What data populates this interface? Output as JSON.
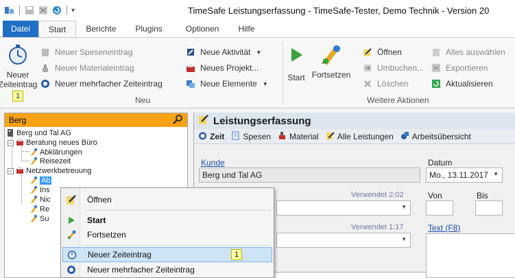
{
  "window": {
    "title": "TimeSafe Leistungserfassung - TimeSafe-Tester, Demo Technik - Version 20"
  },
  "tabs": [
    {
      "label": "Datei"
    },
    {
      "label": "Start"
    },
    {
      "label": "Berichte"
    },
    {
      "label": "Plugins"
    },
    {
      "label": "Optionen"
    },
    {
      "label": "Hilfe"
    }
  ],
  "ribbon": {
    "new_group": {
      "big_button_line1": "Neuer",
      "big_button_line2": "Zeiteintrag",
      "big_button_keytip": "1",
      "items": [
        {
          "label": "Neuer Speseneintrag",
          "icon": "expense-icon",
          "enabled": false
        },
        {
          "label": "Neuer Materialeintrag",
          "icon": "material-icon",
          "enabled": false
        },
        {
          "label": "Neuer mehrfacher Zeiteintrag",
          "icon": "multi-time-icon",
          "enabled": true
        }
      ],
      "items2": [
        {
          "label": "Neue Aktivität",
          "icon": "activity-icon",
          "dropdown": true
        },
        {
          "label": "Neues Projekt...",
          "icon": "project-icon",
          "dropdown": false
        },
        {
          "label": "Neue Elemente",
          "icon": "elements-icon",
          "dropdown": true
        }
      ],
      "label": "Neu"
    },
    "actions_group": {
      "start_label": "Start",
      "continue_label": "Fortsetzen",
      "col1": [
        {
          "label": "Öffnen",
          "icon": "open-icon",
          "enabled": true
        },
        {
          "label": "Umbuchen...",
          "icon": "rebook-icon",
          "enabled": false
        },
        {
          "label": "Löschen",
          "icon": "delete-icon",
          "enabled": false
        }
      ],
      "col2": [
        {
          "label": "Alles auswählen",
          "icon": "select-all-icon",
          "enabled": false
        },
        {
          "label": "Exportieren",
          "icon": "export-icon",
          "enabled": false
        },
        {
          "label": "Aktualisieren",
          "icon": "refresh-icon",
          "enabled": true
        }
      ],
      "label": "Weitere Aktionen"
    }
  },
  "left_panel": {
    "search_value": "Berg",
    "tree": [
      {
        "label": "Berg und Tal AG"
      },
      {
        "label": "Beratung neues Büro"
      },
      {
        "label": "Abklärungen"
      },
      {
        "label": "Reisezeit"
      },
      {
        "label": "Netzwerkbetreuung"
      },
      {
        "label": "Ab"
      },
      {
        "label": "Ins"
      },
      {
        "label": "Nic"
      },
      {
        "label": "Re"
      },
      {
        "label": "Su"
      }
    ]
  },
  "right_panel": {
    "header": "Leistungserfassung",
    "subtabs": [
      {
        "label": "Zeit"
      },
      {
        "label": "Spesen"
      },
      {
        "label": "Material"
      },
      {
        "label": "Alle Leistungen"
      },
      {
        "label": "Arbeitsübersicht"
      }
    ],
    "kunde_label": "Kunde",
    "kunde_value": "Berg und Tal AG",
    "datum_label": "Datum",
    "datum_value": "Mo., 13.11.2017",
    "verwendet_1": "Verwendet 2:02",
    "verwendet_2": "Verwendet 1:17",
    "von_label": "Von",
    "bis_label": "Bis",
    "text_label": "Text (F8)"
  },
  "context_menu": {
    "items": [
      {
        "label": "Öffnen"
      },
      {
        "label": "Start"
      },
      {
        "label": "Fortsetzen"
      },
      {
        "label": "Neuer Zeiteintrag",
        "keytip": "1"
      },
      {
        "label": "Neuer mehrfacher Zeiteintrag"
      }
    ]
  }
}
